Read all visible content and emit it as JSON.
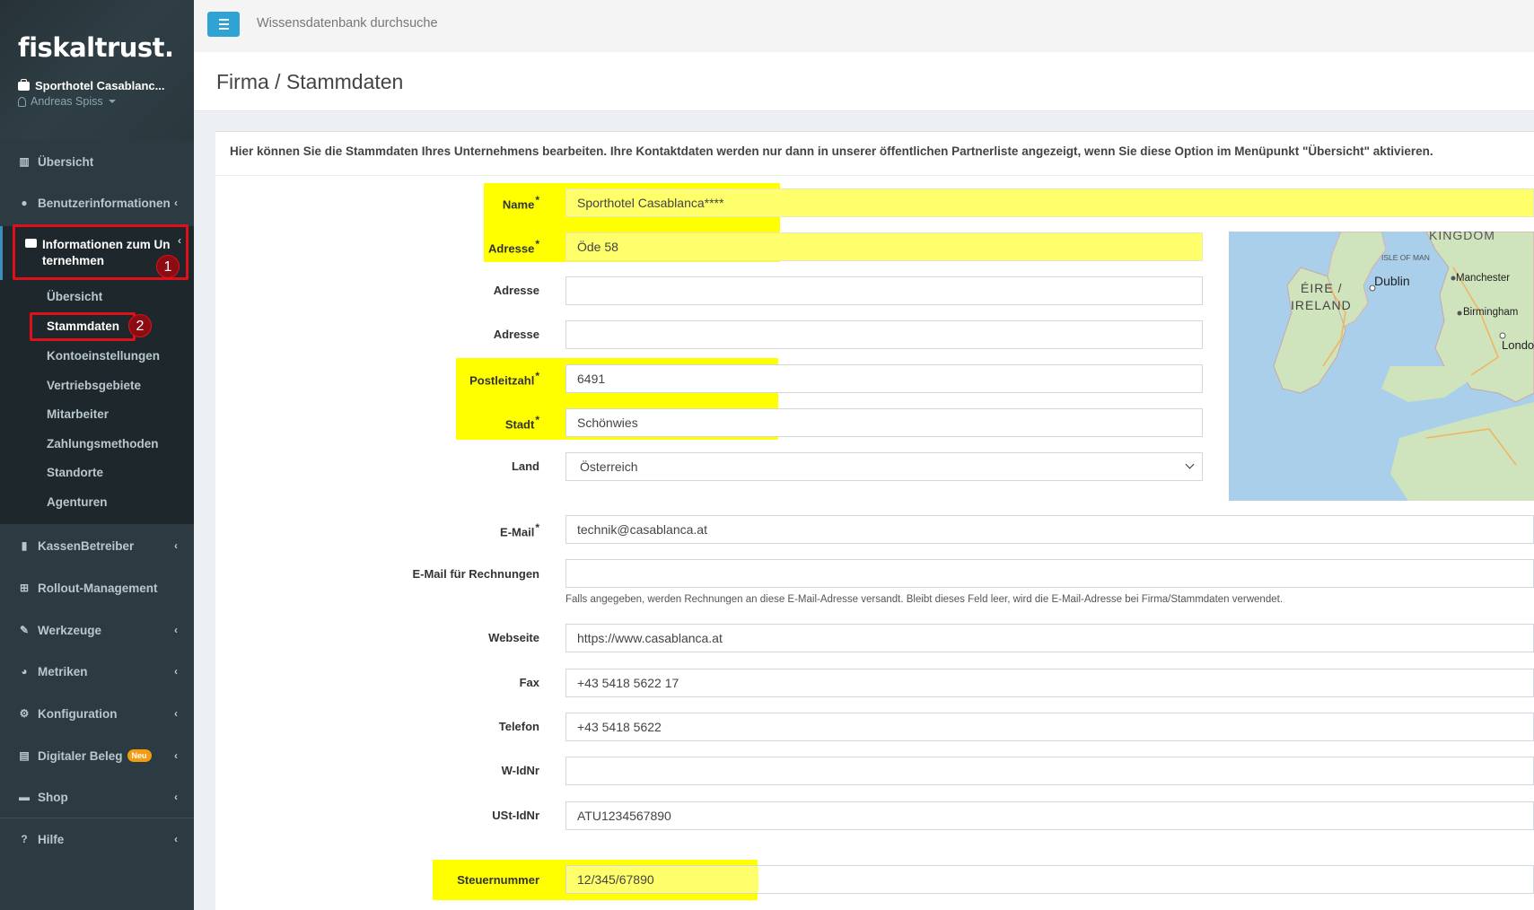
{
  "sidebar": {
    "logo": "fiskaltrust.",
    "company": "Sporthotel Casablanc...",
    "user": "Andreas Spiss",
    "items": [
      {
        "label": "Übersicht"
      },
      {
        "label": "Benutzerinformationen"
      },
      {
        "label": "Informationen zum Unternehmen"
      },
      {
        "label": "KassenBetreiber"
      },
      {
        "label": "Rollout-Management"
      },
      {
        "label": "Werkzeuge"
      },
      {
        "label": "Metriken"
      },
      {
        "label": "Konfiguration"
      },
      {
        "label": "Digitaler Beleg",
        "badge": "Neu"
      },
      {
        "label": "Shop"
      },
      {
        "label": "Hilfe"
      }
    ],
    "active_group_label_line1": "Informationen zum Un",
    "active_group_label_line2": "ternehmen",
    "sub_items": [
      {
        "label": "Übersicht"
      },
      {
        "label": "Stammdaten"
      },
      {
        "label": "Kontoeinstellungen"
      },
      {
        "label": "Vertriebsgebiete"
      },
      {
        "label": "Mitarbeiter"
      },
      {
        "label": "Zahlungsmethoden"
      },
      {
        "label": "Standorte"
      },
      {
        "label": "Agenturen"
      }
    ],
    "annotations": [
      "1",
      "2"
    ]
  },
  "topbar": {
    "search_placeholder": "Wissensdatenbank durchsuche"
  },
  "page": {
    "title": "Firma / Stammdaten",
    "intro": "Hier können Sie die Stammdaten Ihres Unternehmens bearbeiten. Ihre Kontaktdaten werden nur dann in unserer öffentlichen Partnerliste angezeigt, wenn Sie diese Option im Menüpunkt \"Übersicht\" aktivieren."
  },
  "form": {
    "name": {
      "label": "Name",
      "value": "Sporthotel Casablanca****"
    },
    "address1": {
      "label": "Adresse",
      "value": "Öde 58"
    },
    "address2": {
      "label": "Adresse",
      "value": ""
    },
    "address3": {
      "label": "Adresse",
      "value": ""
    },
    "zip": {
      "label": "Postleitzahl",
      "value": "6491"
    },
    "city": {
      "label": "Stadt",
      "value": "Schönwies"
    },
    "country": {
      "label": "Land",
      "value": "Österreich"
    },
    "email": {
      "label": "E-Mail",
      "value": "technik@casablanca.at"
    },
    "invoice_email": {
      "label": "E-Mail für Rechnungen",
      "value": "",
      "help": "Falls angegeben, werden Rechnungen an diese E-Mail-Adresse versandt. Bleibt dieses Feld leer, wird die E-Mail-Adresse bei Firma/Stammdaten verwendet."
    },
    "website": {
      "label": "Webseite",
      "value": "https://www.casablanca.at"
    },
    "fax": {
      "label": "Fax",
      "value": "+43 5418 5622 17"
    },
    "phone": {
      "label": "Telefon",
      "value": "+43 5418 5622"
    },
    "widnr": {
      "label": "W-IdNr",
      "value": ""
    },
    "ustidnr": {
      "label": "USt-IdNr",
      "value": "ATU1234567890"
    },
    "tax_number": {
      "label": "Steuernummer",
      "value": "12/345/67890"
    },
    "required_mark": "*"
  },
  "map": {
    "labels": {
      "kingdom": "KINGDOM",
      "isle_of_man": "ISLE OF MAN",
      "eire": "ÉIRE /",
      "ireland": "IRELAND",
      "dublin": "Dublin",
      "manchester": "Manchester",
      "birmingham": "Birmingham",
      "london": "Londo"
    }
  }
}
